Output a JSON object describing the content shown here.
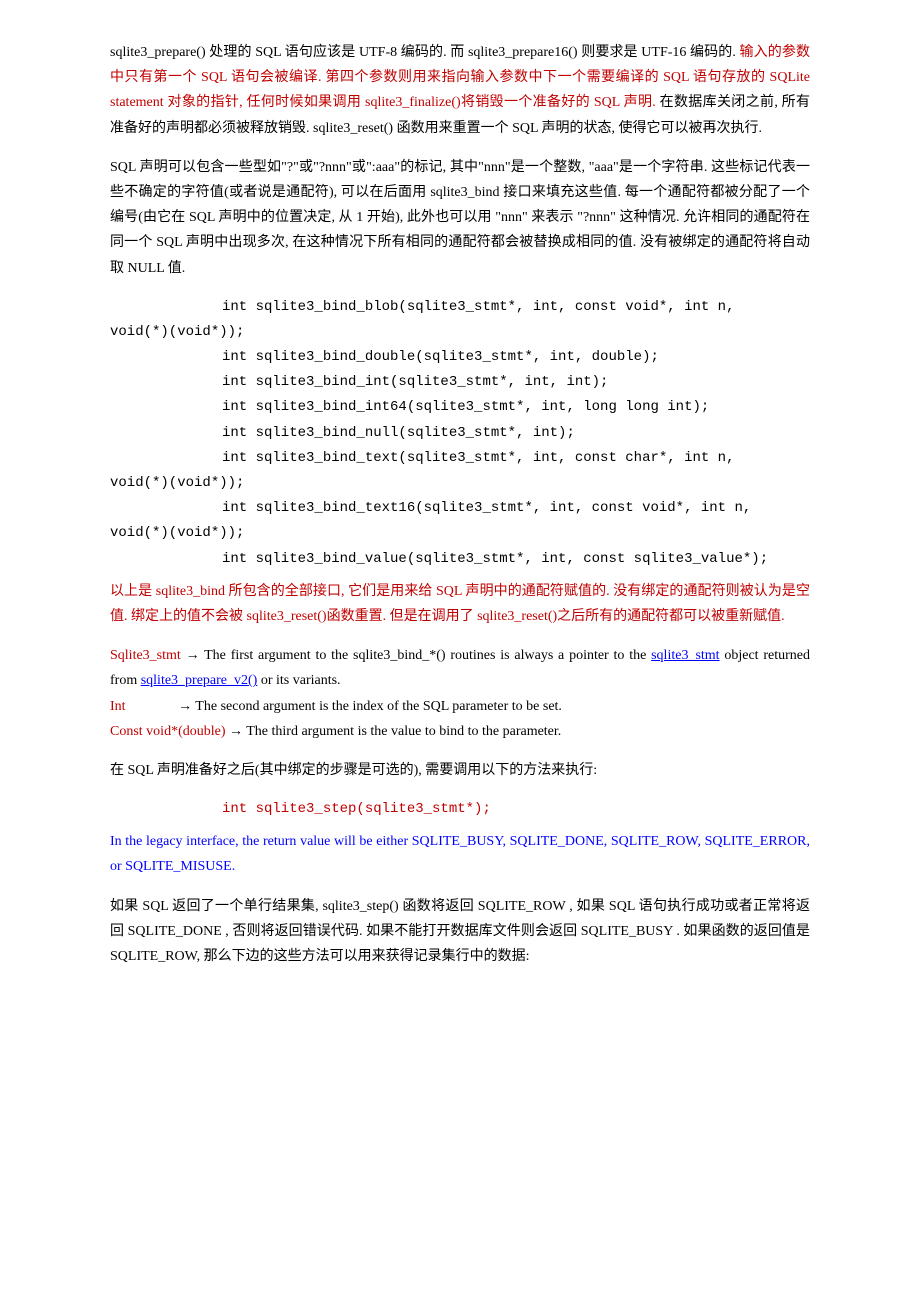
{
  "p1": {
    "t1": "sqlite3_prepare() 处理的 SQL 语句应该是 UTF-8 编码的. 而 sqlite3_prepare16() 则要求是 UTF-16 编码的. ",
    "t2": "输入的参数中只有第一个 SQL 语句会被编译. 第四个参数则用来指向输入参数中下一个需要编译的 SQL 语句存放的 SQLite statement 对象的指针, 任何时候如果调用 sqlite3_finalize()将销毁一个准备好的 SQL 声明. ",
    "t3": "在数据库关闭之前, 所有准备好的声明都必须被释放销毁. sqlite3_reset() 函数用来重置一个 SQL 声明的状态, 使得它可以被再次执行."
  },
  "p2": "SQL 声明可以包含一些型如\"?\"或\"?nnn\"或\":aaa\"的标记, 其中\"nnn\"是一个整数, \"aaa\"是一个字符串. 这些标记代表一些不确定的字符值(或者说是通配符), 可以在后面用 sqlite3_bind 接口来填充这些值. 每一个通配符都被分配了一个编号(由它在 SQL 声明中的位置决定, 从 1 开始), 此外也可以用 \"nnn\" 来表示 \"?nnn\" 这种情况. 允许相同的通配符在同一个 SQL 声明中出现多次, 在这种情况下所有相同的通配符都会被替换成相同的值. 没有被绑定的通配符将自动取 NULL 值.",
  "code": {
    "l1": "int sqlite3_bind_blob(sqlite3_stmt*, int, const void*, int n, ",
    "l1b": "void(*)(void*));",
    "l2": "int sqlite3_bind_double(sqlite3_stmt*, int, double);",
    "l3": "int sqlite3_bind_int(sqlite3_stmt*, int, int);",
    "l4": "int sqlite3_bind_int64(sqlite3_stmt*, int, long long int);",
    "l5": "int sqlite3_bind_null(sqlite3_stmt*, int);",
    "l6": "int sqlite3_bind_text(sqlite3_stmt*, int, const char*, int n, ",
    "l6b": "void(*)(void*));",
    "l7": "int sqlite3_bind_text16(sqlite3_stmt*, int, const void*, int n, ",
    "l7b": "void(*)(void*));",
    "l8": "int sqlite3_bind_value(sqlite3_stmt*, int, const sqlite3_value*);"
  },
  "p3": "以上是 sqlite3_bind 所包含的全部接口, 它们是用来给 SQL 声明中的通配符赋值的. 没有绑定的通配符则被认为是空值. 绑定上的值不会被 sqlite3_reset()函数重置. 但是在调用了 sqlite3_reset()之后所有的通配符都可以被重新赋值.",
  "p4": {
    "a1": "Sqlite3_stmt ",
    "arrow": "→",
    "a2": " The first argument to the sqlite3_bind_*() routines is always a pointer to the ",
    "link1": "sqlite3_stmt",
    "a3": " object returned from ",
    "link2": "sqlite3_prepare_v2()",
    "a4": " or its variants.",
    "b1": "Int",
    "b1pad": "               ",
    "b2": " The second argument is the index of the SQL parameter to be set.",
    "c1": "Const void*(double) ",
    "c2": " The third argument is the value to bind to the parameter."
  },
  "p5": "在 SQL 声明准备好之后(其中绑定的步骤是可选的), 需要调用以下的方法来执行:",
  "code2": "int sqlite3_step(sqlite3_stmt*);",
  "p6": "In the legacy interface, the return value will be either SQLITE_BUSY, SQLITE_DONE, SQLITE_ROW, SQLITE_ERROR, or SQLITE_MISUSE.",
  "p7": "如果 SQL 返回了一个单行结果集, sqlite3_step() 函数将返回 SQLITE_ROW , 如果 SQL 语句执行成功或者正常将返回 SQLITE_DONE , 否则将返回错误代码. 如果不能打开数据库文件则会返回 SQLITE_BUSY . 如果函数的返回值是 SQLITE_ROW, 那么下边的这些方法可以用来获得记录集行中的数据:"
}
